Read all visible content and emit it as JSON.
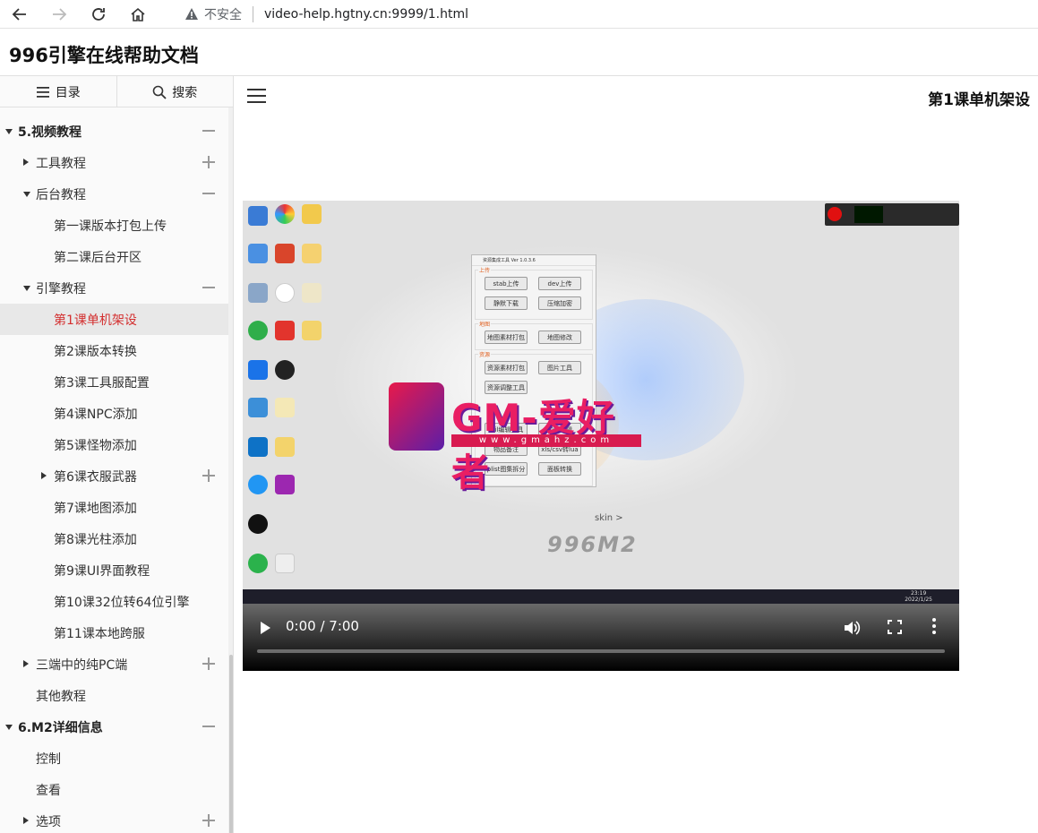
{
  "browser": {
    "insecure_label": "不安全",
    "url": "video-help.hgtny.cn:9999/1.html"
  },
  "site": {
    "title": "996引擎在线帮助文档"
  },
  "sidebar": {
    "tabs": [
      {
        "label": "目录",
        "icon": "list-icon"
      },
      {
        "label": "搜索",
        "icon": "search-icon"
      }
    ],
    "items": [
      {
        "label": "5.视频教程",
        "level": 0,
        "expander": "down",
        "toggle": "minus"
      },
      {
        "label": "工具教程",
        "level": 1,
        "expander": "right",
        "toggle": "plus"
      },
      {
        "label": "后台教程",
        "level": 1,
        "expander": "down",
        "toggle": "minus"
      },
      {
        "label": "第一课版本打包上传",
        "level": 2
      },
      {
        "label": "第二课后台开区",
        "level": 2
      },
      {
        "label": "引擎教程",
        "level": 1,
        "expander": "down",
        "toggle": "minus"
      },
      {
        "label": "第1课单机架设",
        "level": 2,
        "active": true
      },
      {
        "label": "第2课版本转换",
        "level": 2
      },
      {
        "label": "第3课工具服配置",
        "level": 2
      },
      {
        "label": "第4课NPC添加",
        "level": 2
      },
      {
        "label": "第5课怪物添加",
        "level": 2
      },
      {
        "label": "第6课衣服武器",
        "level": 2,
        "expander": "right",
        "toggle": "plus"
      },
      {
        "label": "第7课地图添加",
        "level": 2
      },
      {
        "label": "第8课光柱添加",
        "level": 2
      },
      {
        "label": "第9课UI界面教程",
        "level": 2
      },
      {
        "label": "第10课32位转64位引擎",
        "level": 2
      },
      {
        "label": "第11课本地跨服",
        "level": 2
      },
      {
        "label": "三端中的纯PC端",
        "level": 1,
        "expander": "right",
        "toggle": "plus"
      },
      {
        "label": "其他教程",
        "level": 1
      },
      {
        "label": "6.M2详细信息",
        "level": 0,
        "expander": "down",
        "toggle": "minus"
      },
      {
        "label": "控制",
        "level": 1
      },
      {
        "label": "查看",
        "level": 1
      },
      {
        "label": "选项",
        "level": 1,
        "expander": "right",
        "toggle": "plus"
      }
    ]
  },
  "content": {
    "title": "第1课单机架设"
  },
  "video": {
    "time": "0:00 / 7:00",
    "watermark": {
      "text": "GM-爱好者",
      "url": "www.gmahz.com"
    },
    "tool_window": {
      "title": "资源集成工具 Ver 1.0.3.6",
      "sections": [
        {
          "label": "上传",
          "buttons": [
            "stab上传",
            "dev上传",
            "静默下载",
            "压缩加密"
          ]
        },
        {
          "label": "地图",
          "buttons": [
            "地图素材打包",
            "地图修改"
          ]
        },
        {
          "label": "资源",
          "buttons": [
            "资源素材打包",
            "图片工具",
            "资源调整工具",
            "Wil编辑工具",
            "内观编辑",
            "物品备注",
            "xls/csv转lua",
            "plist图集拆分",
            "面板转换"
          ]
        }
      ]
    },
    "skin_label": "skin >",
    "brand": "996M2",
    "clock": {
      "time": "23:19",
      "date": "2022/1/25"
    }
  },
  "colors": {
    "active_text": "#d32f2f",
    "watermark": "#e91e63"
  }
}
